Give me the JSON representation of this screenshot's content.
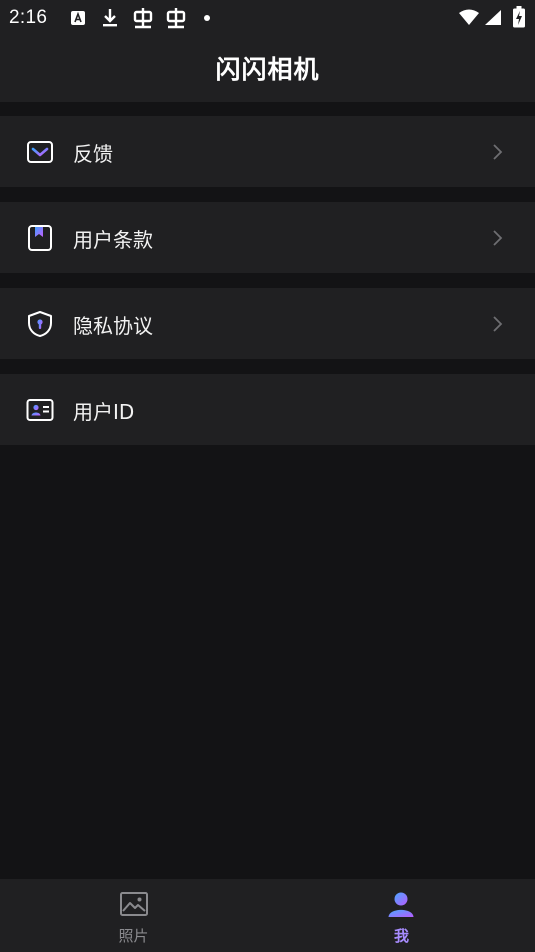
{
  "status_bar": {
    "time": "2:16",
    "icons": [
      "a-notification-icon",
      "download-icon",
      "bug-icon",
      "bug-icon",
      "dot-icon",
      "wifi-icon",
      "signal-icon",
      "battery-charging-icon"
    ]
  },
  "header": {
    "title": "闪闪相机"
  },
  "menu": {
    "items": [
      {
        "label": "反馈",
        "icon": "mail-icon",
        "chevron": true
      },
      {
        "label": "用户条款",
        "icon": "bookmark-icon",
        "chevron": true
      },
      {
        "label": "隐私协议",
        "icon": "shield-icon",
        "chevron": true
      },
      {
        "label": "用户ID",
        "icon": "id-card-icon",
        "chevron": false
      }
    ]
  },
  "tabbar": {
    "tabs": [
      {
        "label": "照片",
        "icon": "photo-icon",
        "active": false
      },
      {
        "label": "我",
        "icon": "user-icon",
        "active": true
      }
    ]
  },
  "colors": {
    "background": "#131315",
    "surface": "#202022",
    "icon_gradient_start": "#3fa0ff",
    "icon_gradient_end": "#c45cff",
    "tab_inactive": "#8a8a8e",
    "tab_active_label": "#a88cff"
  }
}
